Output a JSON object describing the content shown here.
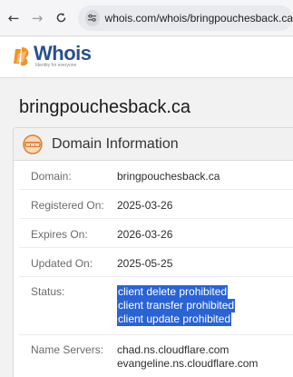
{
  "browser": {
    "url": "whois.com/whois/bringpouchesback.ca"
  },
  "header": {
    "logo_text": "Whois",
    "logo_tagline": "Identity for everyone"
  },
  "page": {
    "title": "bringpouchesback.ca"
  },
  "panel": {
    "title": "Domain Information",
    "rows": [
      {
        "label": "Domain:",
        "value": "bringpouchesback.ca"
      },
      {
        "label": "Registered On:",
        "value": "2025-03-26"
      },
      {
        "label": "Expires On:",
        "value": "2026-03-26"
      },
      {
        "label": "Updated On:",
        "value": "2025-05-25"
      }
    ],
    "status": {
      "label": "Status:",
      "values": [
        "client delete prohibited",
        "client transfer prohibited",
        "client update prohibited"
      ]
    },
    "name_servers": {
      "label": "Name Servers:",
      "values": [
        "chad.ns.cloudflare.com",
        "evangeline.ns.cloudflare.com"
      ]
    }
  },
  "colors": {
    "selection_highlight": "#2a63d4",
    "logo_blue": "#2b4f8f",
    "logo_orange": "#f0932b"
  }
}
